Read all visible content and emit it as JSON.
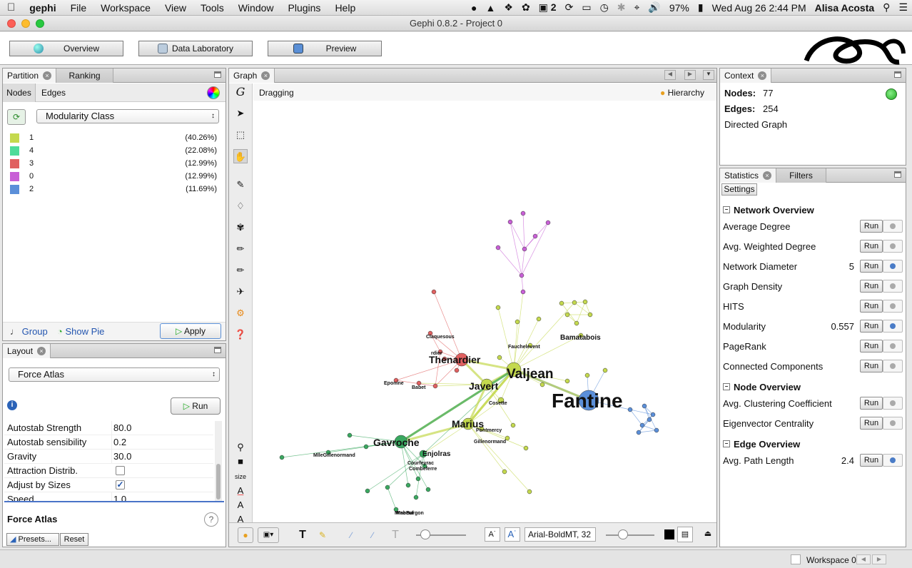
{
  "menubar": {
    "app": "gephi",
    "items": [
      "File",
      "Workspace",
      "View",
      "Tools",
      "Window",
      "Plugins",
      "Help"
    ],
    "status_number": "2",
    "battery": "97%",
    "clock": "Wed Aug 26  2:44 PM",
    "user": "Alisa Acosta"
  },
  "window": {
    "title": "Gephi 0.8.2 - Project 0"
  },
  "workspace_tabs": {
    "overview": "Overview",
    "data_lab": "Data Laboratory",
    "preview": "Preview"
  },
  "partition": {
    "tab_partition": "Partition",
    "tab_ranking": "Ranking",
    "sub_nodes": "Nodes",
    "sub_edges": "Edges",
    "selector": "Modularity Class",
    "items": [
      {
        "label": "1",
        "pct": "(40.26%)",
        "color": "#c4d94e"
      },
      {
        "label": "4",
        "pct": "(22.08%)",
        "color": "#4fdc9a"
      },
      {
        "label": "3",
        "pct": "(12.99%)",
        "color": "#e06060"
      },
      {
        "label": "0",
        "pct": "(12.99%)",
        "color": "#c85fd6"
      },
      {
        "label": "2",
        "pct": "(11.69%)",
        "color": "#5b8fd9"
      }
    ],
    "group": "Group",
    "show_pie": "Show Pie",
    "apply": "Apply"
  },
  "layout": {
    "tab": "Layout",
    "algorithm": "Force Atlas",
    "run": "Run",
    "props": [
      {
        "name": "Autostab Strength",
        "value": "80.0"
      },
      {
        "name": "Autostab sensibility",
        "value": "0.2"
      },
      {
        "name": "Gravity",
        "value": "30.0"
      },
      {
        "name": "Attraction Distrib.",
        "value": ""
      },
      {
        "name": "Adjust by Sizes",
        "value": ""
      },
      {
        "name": "Speed",
        "value": "1.0"
      }
    ],
    "desc_title": "Force Atlas",
    "presets": "Presets...",
    "reset": "Reset"
  },
  "graph": {
    "tab": "Graph",
    "mode": "Dragging",
    "hierarchy": "Hierarchy",
    "size_label": "size",
    "font_label": "Arial-BoldMT, 32",
    "labels": [
      {
        "text": "Fantine",
        "cls": "xl"
      },
      {
        "text": "Valjean",
        "cls": "l"
      },
      {
        "text": "Thenardier",
        "cls": "m"
      },
      {
        "text": "Javert",
        "cls": "m"
      },
      {
        "text": "Gavroche",
        "cls": "m"
      },
      {
        "text": "Marius",
        "cls": "m"
      },
      {
        "text": "Enjolras",
        "cls": "s"
      },
      {
        "text": "Bamatabois",
        "cls": "s"
      },
      {
        "text": "Cosette",
        "cls": "xs"
      },
      {
        "text": "Fauchelevent",
        "cls": "xs"
      },
      {
        "text": "Claquesous",
        "cls": "xs"
      },
      {
        "text": "rdier",
        "cls": "xs"
      },
      {
        "text": "Babet",
        "cls": "xs"
      },
      {
        "text": "Eponine",
        "cls": "xs"
      },
      {
        "text": "Pontmercy",
        "cls": "xs"
      },
      {
        "text": "Gillenormand",
        "cls": "xs"
      },
      {
        "text": "MlleGillenormand",
        "cls": "xs"
      },
      {
        "text": "MmeBurgon",
        "cls": "xs"
      },
      {
        "text": "Courfeyrac",
        "cls": "xs"
      },
      {
        "text": "Combeferre",
        "cls": "xs"
      },
      {
        "text": "Mabeuf",
        "cls": "xs"
      }
    ]
  },
  "context": {
    "tab": "Context",
    "nodes_label": "Nodes:",
    "nodes_value": "77",
    "edges_label": "Edges:",
    "edges_value": "254",
    "type": "Directed Graph"
  },
  "statistics": {
    "tab_stats": "Statistics",
    "tab_filters": "Filters",
    "settings": "Settings",
    "run": "Run",
    "sections": [
      {
        "title": "Network Overview",
        "items": [
          {
            "name": "Average Degree",
            "value": "",
            "help": false
          },
          {
            "name": "Avg. Weighted Degree",
            "value": "",
            "help": false
          },
          {
            "name": "Network Diameter",
            "value": "5",
            "help": true
          },
          {
            "name": "Graph Density",
            "value": "",
            "help": false
          },
          {
            "name": "HITS",
            "value": "",
            "help": false
          },
          {
            "name": "Modularity",
            "value": "0.557",
            "help": true
          },
          {
            "name": "PageRank",
            "value": "",
            "help": false
          },
          {
            "name": "Connected Components",
            "value": "",
            "help": false
          }
        ]
      },
      {
        "title": "Node Overview",
        "items": [
          {
            "name": "Avg. Clustering Coefficient",
            "value": "",
            "help": false
          },
          {
            "name": "Eigenvector Centrality",
            "value": "",
            "help": false
          }
        ]
      },
      {
        "title": "Edge Overview",
        "items": [
          {
            "name": "Avg. Path Length",
            "value": "2.4",
            "help": true
          }
        ]
      }
    ]
  },
  "statusbar": {
    "workspace": "Workspace 0"
  }
}
